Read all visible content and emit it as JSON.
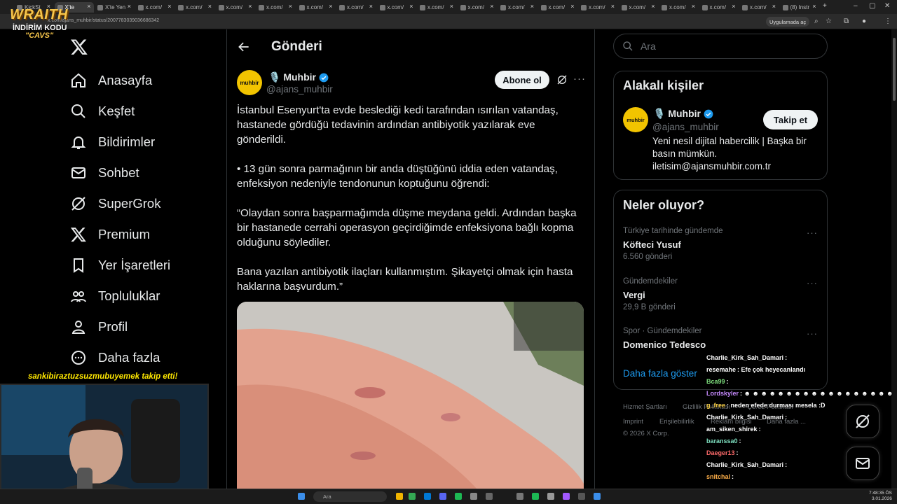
{
  "browser": {
    "tabs": [
      "KickSt",
      "X'te",
      "X'te Yen",
      "x.com/",
      "x.com/",
      "x.com/",
      "x.com/",
      "x.com/",
      "x.com/",
      "x.com/",
      "x.com/",
      "x.com/",
      "x.com/",
      "x.com/",
      "x.com/",
      "x.com/",
      "x.com/",
      "x.com/",
      "x.com/",
      "(8) Instr"
    ],
    "url": "x.com/ajans_muhbir/status/2007783039036686342",
    "open_in_app": "Uygulamada aç"
  },
  "overlay": {
    "brand": "WRAITH",
    "promo_line1": "İNDİRİM KODU",
    "promo_line2": "\"CAVS\"",
    "follow_alert": "sankibiraztuzsuzmubuyemek takip etti!"
  },
  "nav": {
    "items": [
      {
        "label": "Anasayfa",
        "icon": "home-icon"
      },
      {
        "label": "Keşfet",
        "icon": "search-icon"
      },
      {
        "label": "Bildirimler",
        "icon": "bell-icon"
      },
      {
        "label": "Sohbet",
        "icon": "mail-icon"
      },
      {
        "label": "SuperGrok",
        "icon": "grok-icon"
      },
      {
        "label": "Premium",
        "icon": "x-icon"
      },
      {
        "label": "Yer İşaretleri",
        "icon": "bookmark-icon"
      },
      {
        "label": "Topluluklar",
        "icon": "communities-icon"
      },
      {
        "label": "Profil",
        "icon": "profile-icon"
      },
      {
        "label": "Daha fazla",
        "icon": "more-circle-icon"
      }
    ]
  },
  "post": {
    "header_title": "Gönderi",
    "avatar_text": "muhbir",
    "author_name": "🎙️ Muhbir",
    "author_handle": "@ajans_muhbir",
    "subscribe_label": "Abone ol",
    "paragraphs": [
      "İstanbul Esenyurt'ta evde beslediği kedi tarafından ısırılan vatandaş, hastanede gördüğü tedavinin ardından antibiyotik yazılarak eve gönderildi.",
      "• 13 gün sonra parmağının bir anda düştüğünü iddia eden vatandaş, enfeksiyon nedeniyle tendonunun koptuğunu öğrendi:",
      "“Olaydan sonra başparmağımda düşme meydana geldi. Ardından başka bir hastanede cerrahi operasyon geçirdiğimde enfeksiyona bağlı kopma olduğunu söylediler.",
      "Bana yazılan antibiyotik ilaçları kullanmıştım. Şikayetçi olmak için hasta haklarına başvurdum.”"
    ]
  },
  "sidebar": {
    "search_placeholder": "Ara",
    "related": {
      "title": "Alakalı kişiler",
      "avatar_text": "muhbir",
      "name": "🎙️ Muhbir",
      "handle": "@ajans_muhbir",
      "follow_label": "Takip et",
      "bio": "Yeni nesil dijital habercilik | Başka bir basın mümkün. iletisim@ajansmuhbir.com.tr"
    },
    "trends": {
      "title": "Neler oluyor?",
      "items": [
        {
          "context": "Türkiye tarihinde gündemde",
          "name": "Köfteci Yusuf",
          "count": "6.560 gönderi"
        },
        {
          "context": "Gündemdekiler",
          "name": "Vergi",
          "count": "29,9 B gönderi"
        },
        {
          "context": "Spor · Gündemdekiler",
          "name": "Domenico Tedesco",
          "count": ""
        }
      ],
      "show_more": "Daha fazla göster"
    },
    "footer": [
      "Hizmet Şartları",
      "Gizlilik Politikası",
      "Çerez Politikası",
      "Imprint",
      "Erişilebilirlik",
      "Reklam bilgisi",
      "Daha fazla ...",
      "© 2026 X Corp."
    ]
  },
  "chat": [
    {
      "user": "Charlie_Kirk_Sah_Damari",
      "msg": ":",
      "color": "#ffffff"
    },
    {
      "user": "resemahe",
      "msg": ": Efe çok heyecanlandı",
      "color": "#ffffff"
    },
    {
      "user": "Bca99",
      "msg": ":",
      "color": "#7ee07e"
    },
    {
      "user": "Lordskyler",
      "msg": ": ☻ ☻ ☻ ☻ ☻ ☻ ☻ ☻ ☻ ☻ ☻ ☻ ☻ ☻ ☻ ☻ ☻ ☻",
      "color": "#c78bff"
    },
    {
      "user": "g_free",
      "msg": ": neden efede durması mesela :D",
      "color": "#ffd54a"
    },
    {
      "user": "Charlie_Kirk_Sah_Damari",
      "msg": ":",
      "color": "#ffffff"
    },
    {
      "user": "am_siken_shirek",
      "msg": ":",
      "color": "#ffffff"
    },
    {
      "user": "baranssa0",
      "msg": ":",
      "color": "#7ee0c0"
    },
    {
      "user": "Daeger13",
      "msg": ":",
      "color": "#ff6b6b"
    },
    {
      "user": "Charlie_Kirk_Sah_Damari",
      "msg": ":",
      "color": "#ffffff"
    },
    {
      "user": "snitchal",
      "msg": ":",
      "color": "#ffb04a"
    }
  ],
  "taskbar": {
    "search_placeholder": "Ara",
    "time": "7:48:35 ÖS",
    "date": "3.01.2026"
  }
}
